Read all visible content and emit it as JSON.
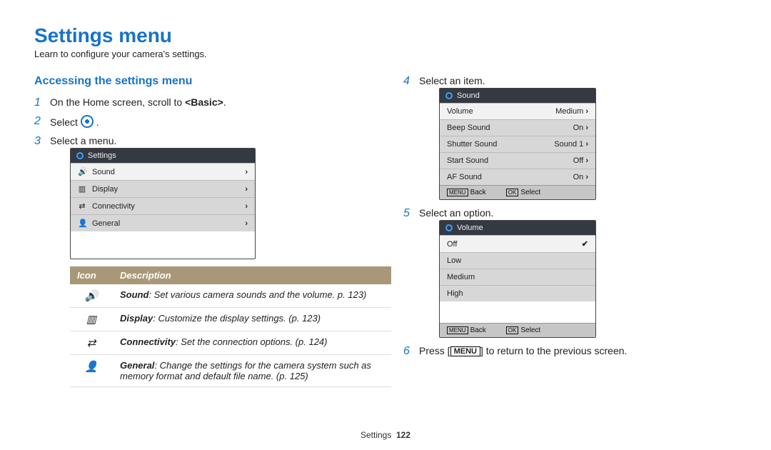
{
  "title": "Settings menu",
  "intro": "Learn to configure your camera's settings.",
  "section_heading": "Accessing the settings menu",
  "steps_left": {
    "s1_pre": "On the Home screen, scroll to ",
    "s1_bold": "<Basic>",
    "s1_post": ".",
    "s2_pre": "Select ",
    "s2_post": " .",
    "s3": "Select a menu."
  },
  "menu_screen": {
    "header": "Settings",
    "rows": [
      {
        "icon": "sound-icon",
        "label": "Sound"
      },
      {
        "icon": "display-icon",
        "label": "Display"
      },
      {
        "icon": "connectivity-icon",
        "label": "Connectivity"
      },
      {
        "icon": "general-icon",
        "label": "General"
      }
    ]
  },
  "idesc": {
    "head_icon": "Icon",
    "head_desc": "Description",
    "rows": [
      {
        "icon": "sound-icon",
        "bold": "Sound",
        "text": ": Set various camera sounds and the volume. p. 123)"
      },
      {
        "icon": "display-icon",
        "bold": "Display",
        "text": ": Customize the display settings. (p. 123)"
      },
      {
        "icon": "connectivity-icon",
        "bold": "Connectivity",
        "text": ": Set the connection options. (p. 124)"
      },
      {
        "icon": "general-icon",
        "bold": "General",
        "text": ": Change the settings for the camera system such as memory format and default file name. (p. 125)"
      }
    ]
  },
  "steps_right": {
    "s4": "Select an item.",
    "s5": "Select an option.",
    "s6_pre": "Press [",
    "s6_key": "MENU",
    "s6_post": "] to return to the previous screen."
  },
  "item_screen": {
    "header": "Sound",
    "rows": [
      {
        "label": "Volume",
        "value": "Medium",
        "sel": true
      },
      {
        "label": "Beep Sound",
        "value": "On"
      },
      {
        "label": "Shutter Sound",
        "value": "Sound 1"
      },
      {
        "label": "Start Sound",
        "value": "Off"
      },
      {
        "label": "AF Sound",
        "value": "On"
      }
    ],
    "back": "Back",
    "select": "Select",
    "menu_key": "MENU",
    "ok_key": "OK"
  },
  "option_screen": {
    "header": "Volume",
    "rows": [
      {
        "label": "Off",
        "checked": true
      },
      {
        "label": "Low"
      },
      {
        "label": "Medium"
      },
      {
        "label": "High"
      }
    ],
    "back": "Back",
    "select": "Select",
    "menu_key": "MENU",
    "ok_key": "OK"
  },
  "footer_label": "Settings",
  "footer_page": "122",
  "glyphs": {
    "sound-icon": "🔊",
    "display-icon": "▥",
    "connectivity-icon": "⇄",
    "general-icon": "👤",
    "chevron": "›",
    "check": "✔"
  }
}
